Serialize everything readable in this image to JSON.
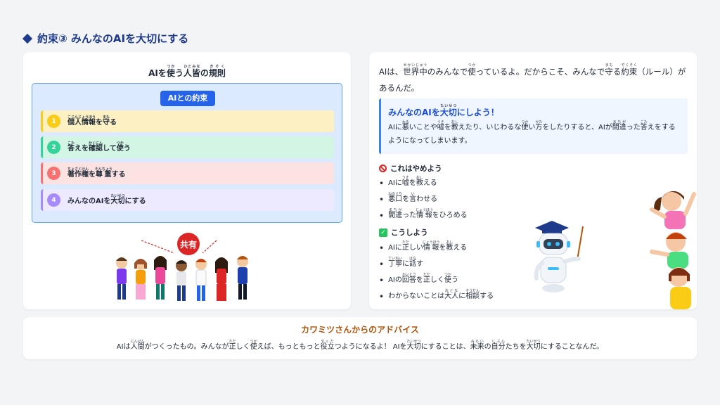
{
  "page_title": "約束③ みんなのAIを大切にする",
  "left": {
    "title": [
      {
        "t": "AIを"
      },
      {
        "t": "使",
        "r": "つか"
      },
      {
        "t": "う"
      },
      {
        "t": "人皆",
        "r": "ひとみな"
      },
      {
        "t": "の"
      },
      {
        "t": "規則",
        "r": "きそく"
      }
    ],
    "badge": "AIとの約束",
    "rules": [
      {
        "num": "1",
        "parts": [
          {
            "t": "個人情報",
            "r": "こじんじょうほう"
          },
          {
            "t": "を"
          },
          {
            "t": "守",
            "r": "まも"
          },
          {
            "t": "る"
          }
        ]
      },
      {
        "num": "2",
        "parts": [
          {
            "t": "答",
            "r": "こた"
          },
          {
            "t": "えを"
          },
          {
            "t": "確認",
            "r": "かくにん"
          },
          {
            "t": "して"
          },
          {
            "t": "使",
            "r": "つか"
          },
          {
            "t": "う"
          }
        ]
      },
      {
        "num": "3",
        "parts": [
          {
            "t": "著作権",
            "r": "ちょさくけん"
          },
          {
            "t": "を"
          },
          {
            "t": "尊重",
            "r": "そんちょう"
          },
          {
            "t": "する"
          }
        ]
      },
      {
        "num": "4",
        "parts": [
          {
            "t": "みんなのAIを"
          },
          {
            "t": "大切",
            "r": "たいせつ"
          },
          {
            "t": "にする"
          }
        ]
      }
    ],
    "share_label": "共有"
  },
  "right": {
    "intro": [
      {
        "t": "AIは、"
      },
      {
        "t": "世界中",
        "r": "せかいじゅう"
      },
      {
        "t": "のみんなで"
      },
      {
        "t": "使",
        "r": "つか"
      },
      {
        "t": "っているよ。だからこそ、みんなで"
      },
      {
        "t": "守",
        "r": "まも"
      },
      {
        "t": "る"
      },
      {
        "t": "約束",
        "r": "やくそく"
      },
      {
        "t": "（ルール）があるんだ。"
      }
    ],
    "callout_title": [
      {
        "t": "みんなのAIを"
      },
      {
        "t": "大切",
        "r": "たいせつ"
      },
      {
        "t": "にしよう！"
      }
    ],
    "callout_body": [
      {
        "t": "AIに"
      },
      {
        "t": "悪",
        "r": "わる"
      },
      {
        "t": "いことや"
      },
      {
        "t": "嘘",
        "r": "うそ"
      },
      {
        "t": "を"
      },
      {
        "t": "教",
        "r": "おし"
      },
      {
        "t": "えたり、いじわるな"
      },
      {
        "t": "使",
        "r": "つか"
      },
      {
        "t": "い"
      },
      {
        "t": "方",
        "r": "かた"
      },
      {
        "t": "をしたりすると、AIが"
      },
      {
        "t": "間違",
        "r": "まちが"
      },
      {
        "t": "った"
      },
      {
        "t": "答",
        "r": "こた"
      },
      {
        "t": "えをするようになってしまいます。"
      }
    ],
    "dont_title": "これはやめよう",
    "dont_items": [
      [
        {
          "t": "AIに"
        },
        {
          "t": "嘘",
          "r": "うそ"
        },
        {
          "t": "を"
        },
        {
          "t": "教",
          "r": "おし"
        },
        {
          "t": "える"
        }
      ],
      [
        {
          "t": "悪口",
          "r": "わるぐち"
        },
        {
          "t": "を"
        },
        {
          "t": "言",
          "r": "い"
        },
        {
          "t": "わせる"
        }
      ],
      [
        {
          "t": "間違",
          "r": "まちが"
        },
        {
          "t": "った"
        },
        {
          "t": "情報",
          "r": "じょうほう"
        },
        {
          "t": "をひろめる"
        }
      ]
    ],
    "do_title": "こうしよう",
    "do_items": [
      [
        {
          "t": "AIに"
        },
        {
          "t": "正",
          "r": "ただ"
        },
        {
          "t": "しい"
        },
        {
          "t": "情報",
          "r": "じょうほう"
        },
        {
          "t": "を"
        },
        {
          "t": "教",
          "r": "おし"
        },
        {
          "t": "える"
        }
      ],
      [
        {
          "t": "丁寧",
          "r": "ていねい"
        },
        {
          "t": "に"
        },
        {
          "t": "話",
          "r": "はな"
        },
        {
          "t": "す"
        }
      ],
      [
        {
          "t": "AIの"
        },
        {
          "t": "回答",
          "r": "かいとう"
        },
        {
          "t": "を"
        },
        {
          "t": "正",
          "r": "ただ"
        },
        {
          "t": "しく"
        },
        {
          "t": "使",
          "r": "つか"
        },
        {
          "t": "う"
        }
      ],
      [
        {
          "t": "わからないことは"
        },
        {
          "t": "大人",
          "r": "おとな"
        },
        {
          "t": "に"
        },
        {
          "t": "相談",
          "r": "そうだん"
        },
        {
          "t": "する"
        }
      ]
    ]
  },
  "advice": {
    "title": "カワミツさんからのアドバイス",
    "body": [
      {
        "t": "AIは"
      },
      {
        "t": "人間",
        "r": "にんげん"
      },
      {
        "t": "がつくったもの。みんなが"
      },
      {
        "t": "正",
        "r": "ただ"
      },
      {
        "t": "しく"
      },
      {
        "t": "使",
        "r": "つか"
      },
      {
        "t": "えば、もっともっと"
      },
      {
        "t": "役立",
        "r": "やくだ"
      },
      {
        "t": "つようになるよ！ AIを"
      },
      {
        "t": "大切",
        "r": "たいせつ"
      },
      {
        "t": "にすることは、"
      },
      {
        "t": "未来",
        "r": "みらい"
      },
      {
        "t": "の"
      },
      {
        "t": "自分",
        "r": "じぶん"
      },
      {
        "t": "たちを"
      },
      {
        "t": "大切",
        "r": "たいせつ"
      },
      {
        "t": "にすることなんだ。"
      }
    ]
  }
}
